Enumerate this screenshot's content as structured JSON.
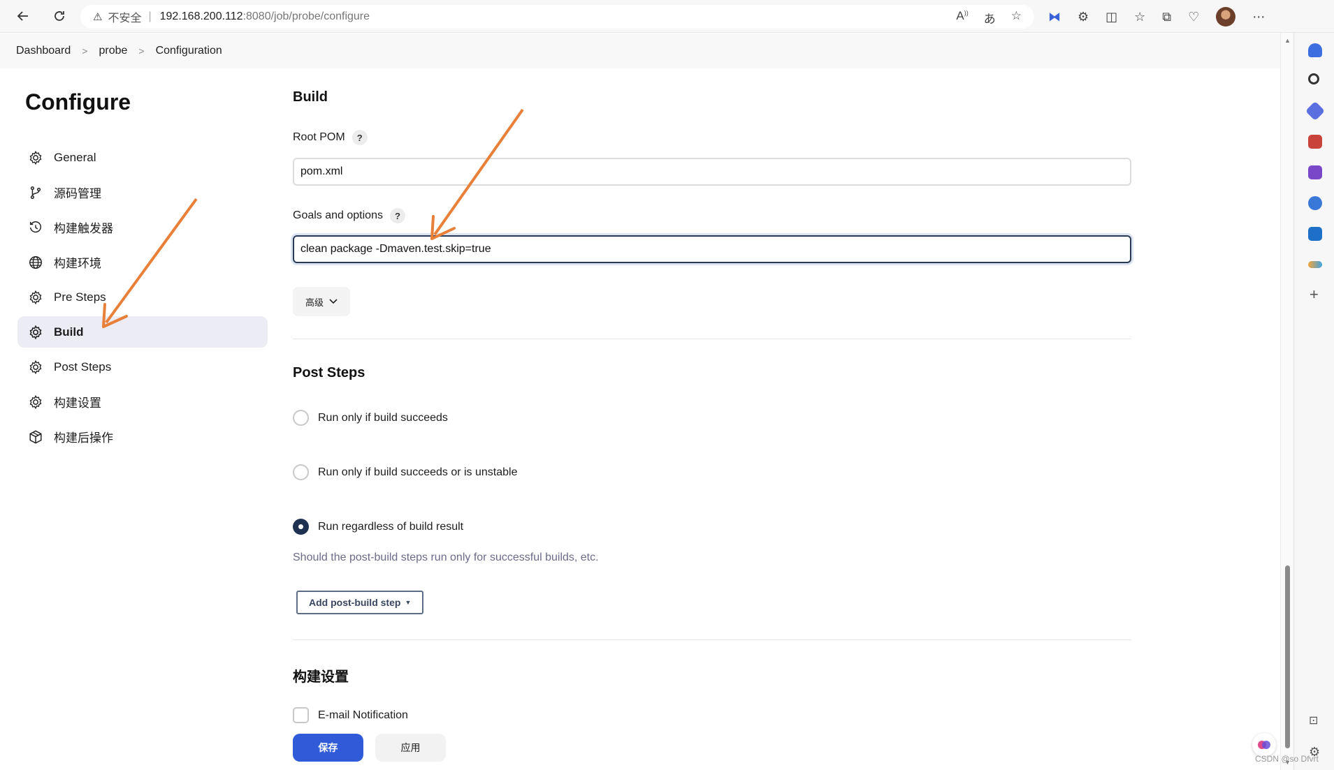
{
  "browser": {
    "security_label": "不安全",
    "url_host": "192.168.200.112",
    "url_path": ":8080/job/probe/configure"
  },
  "breadcrumb": [
    "Dashboard",
    "probe",
    "Configuration"
  ],
  "page_title": "Configure",
  "sidebar": {
    "items": [
      {
        "label": "General",
        "icon": "gear-icon"
      },
      {
        "label": "源码管理",
        "icon": "branch-icon"
      },
      {
        "label": "构建触发器",
        "icon": "clock-icon"
      },
      {
        "label": "构建环境",
        "icon": "globe-icon"
      },
      {
        "label": "Pre Steps",
        "icon": "gear-icon"
      },
      {
        "label": "Build",
        "icon": "gear-icon",
        "active": true
      },
      {
        "label": "Post Steps",
        "icon": "gear-icon"
      },
      {
        "label": "构建设置",
        "icon": "gear-icon"
      },
      {
        "label": "构建后操作",
        "icon": "cube-icon"
      }
    ]
  },
  "build": {
    "title": "Build",
    "root_pom_label": "Root POM",
    "root_pom_value": "pom.xml",
    "goals_label": "Goals and options",
    "goals_value": "clean package -Dmaven.test.skip=true",
    "advanced_label": "高级",
    "help_glyph": "?"
  },
  "post_steps": {
    "title": "Post Steps",
    "options": [
      {
        "label": "Run only if build succeeds",
        "checked": false
      },
      {
        "label": "Run only if build succeeds or is unstable",
        "checked": false
      },
      {
        "label": "Run regardless of build result",
        "checked": true
      }
    ],
    "description": "Should the post-build steps run only for successful builds, etc.",
    "add_step_label": "Add post-build step"
  },
  "build_settings": {
    "title": "构建设置",
    "email_label": "E-mail Notification",
    "email_checked": false
  },
  "actions": {
    "save_label": "保存",
    "apply_label": "应用"
  },
  "watermark": "CSDN @so Dfvrt",
  "colors": {
    "primary": "#2f5bd8",
    "arrow": "#e8803a",
    "radio_checked": "#1f3150"
  }
}
